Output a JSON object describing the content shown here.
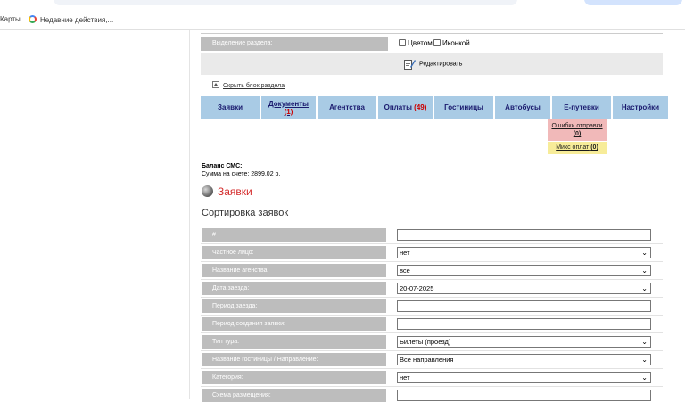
{
  "browser": {
    "bookmarks": [
      {
        "label": "Карты"
      },
      {
        "label": "Недавние действия,..."
      }
    ]
  },
  "section": {
    "highlight_label": "Выделение раздела:",
    "opt_color": "Цветом",
    "opt_icon": "Иконкой",
    "edit_label": "Редактировать",
    "hide_link": "Скрыть блок раздела"
  },
  "tabs": [
    {
      "label": "Заявки"
    },
    {
      "label": "Документы",
      "count": "(1)"
    },
    {
      "label": "Агентства"
    },
    {
      "label": "Оплаты",
      "count": "(49)"
    },
    {
      "label": "Гостиницы"
    },
    {
      "label": "Автобусы"
    },
    {
      "label": "E-путевки"
    },
    {
      "label": "Настройки"
    }
  ],
  "subtabs": {
    "errors_label": "Ошибки отправки",
    "errors_count": "(0)",
    "mix_label": "Микс оплат",
    "mix_count": "(0)"
  },
  "balance": {
    "title": "Баланс СМС:",
    "sum": "Сумма на счете: 2899.02 р."
  },
  "heading": "Заявки",
  "sort_title": "Сортировка заявок",
  "form": [
    {
      "label": "#",
      "type": "input",
      "value": ""
    },
    {
      "label": "Частное лицо:",
      "type": "select",
      "value": "нет"
    },
    {
      "label": "Название агенства:",
      "type": "select",
      "value": "все"
    },
    {
      "label": "Дата заезда:",
      "type": "select",
      "value": "20-07-2025"
    },
    {
      "label": "Период заезда:",
      "type": "input",
      "value": ""
    },
    {
      "label": "Период создания заявки:",
      "type": "input",
      "value": ""
    },
    {
      "label": "Тип тура:",
      "type": "select",
      "value": "Билеты (проезд)"
    },
    {
      "label": "Название гостиницы / Направление:",
      "type": "select",
      "value": "Все направления"
    },
    {
      "label": "Категория:",
      "type": "select",
      "value": "нет"
    },
    {
      "label": "Схема размещения:",
      "type": "input",
      "value": ""
    }
  ]
}
